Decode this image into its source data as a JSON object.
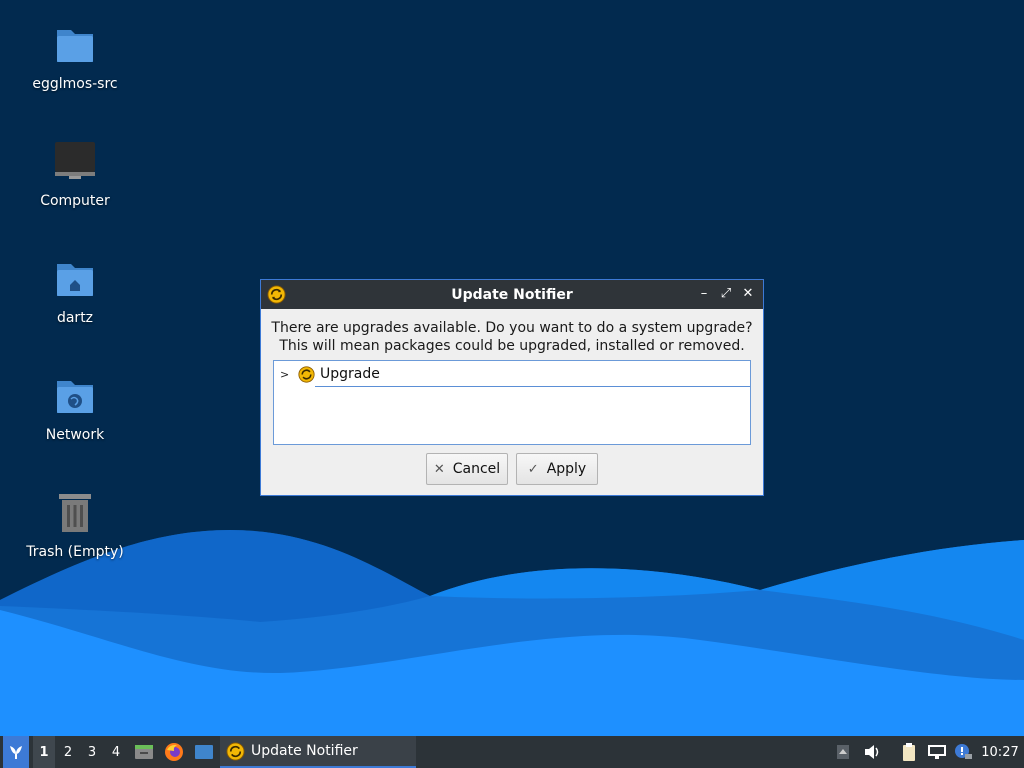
{
  "desktop": {
    "icons": [
      {
        "label": "egglmos-src",
        "icon": "folder-icon"
      },
      {
        "label": "Computer",
        "icon": "computer-icon"
      },
      {
        "label": "dartz",
        "icon": "home-folder-icon"
      },
      {
        "label": "Network",
        "icon": "network-folder-icon"
      },
      {
        "label": "Trash (Empty)",
        "icon": "trash-icon"
      }
    ]
  },
  "dialog": {
    "title": "Update Notifier",
    "message_line1": "There are upgrades available. Do you want to do a system upgrade?",
    "message_line2": "This will mean packages could be upgraded, installed or removed.",
    "tree_item": "Upgrade",
    "cancel_label": "Cancel",
    "apply_label": "Apply",
    "controls": [
      "minimize-icon",
      "maximize-icon",
      "close-icon"
    ]
  },
  "taskbar": {
    "workspaces": [
      "1",
      "2",
      "3",
      "4"
    ],
    "active_workspace": "1",
    "task_label": "Update Notifier",
    "clock": "10:27"
  },
  "colors": {
    "desktop_bg": "#022a4f",
    "wave_light": "#1e90ff",
    "accent": "#3d7ad6",
    "taskbar_bg": "#2c3338"
  }
}
